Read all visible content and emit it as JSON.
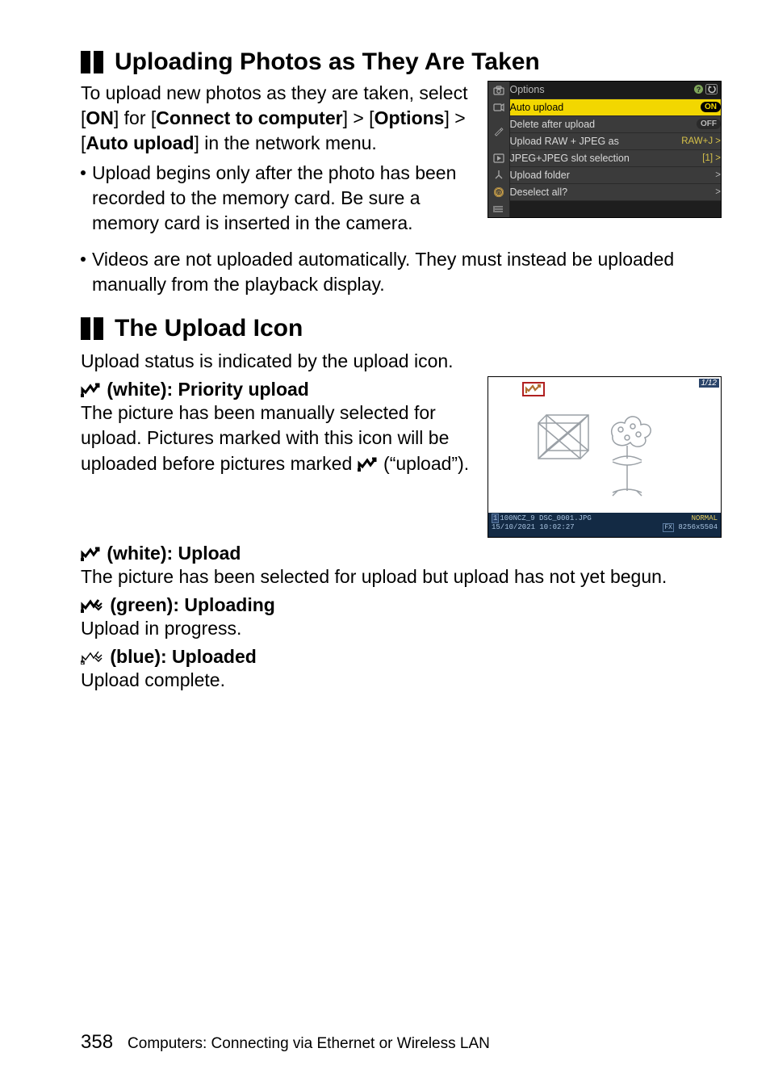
{
  "section1": {
    "heading": "Uploading Photos as They Are Taken",
    "intro_prefix": "To upload new photos as they are taken, select [",
    "intro_on": "ON",
    "intro_mid1": "] for [",
    "intro_connect": "Connect to computer",
    "intro_mid2": "] > [",
    "intro_options": "Options",
    "intro_mid3": "] > [",
    "intro_auto": "Auto upload",
    "intro_suffix": "] in the network menu.",
    "bullet1": "Upload begins only after the photo has been recorded to the memory card. Be sure a memory card is inserted in the camera.",
    "bullet2": "Videos are not uploaded automatically. They must instead be uploaded manually from the playback display."
  },
  "menu_screenshot": {
    "title": "Options",
    "rows": [
      {
        "label": "Auto upload",
        "value": "ON",
        "selected": true,
        "value_style": "pill"
      },
      {
        "label": "Delete after upload",
        "value": "OFF",
        "value_style": "pill-off"
      },
      {
        "label": "Upload RAW + JPEG as",
        "value": "RAW+J >",
        "value_style": "text"
      },
      {
        "label": "JPEG+JPEG slot selection",
        "value": "[1]  >",
        "value_style": "text"
      },
      {
        "label": "Upload folder",
        "value": ">",
        "value_style": "text"
      },
      {
        "label": "Deselect all?",
        "value": ">",
        "value_style": "text"
      }
    ],
    "side_icons": [
      "camera-icon",
      "video-icon",
      "pencil-icon",
      "play-icon",
      "tools-icon",
      "network-icon",
      "mymenu-icon"
    ]
  },
  "section2": {
    "heading": "The Upload Icon",
    "intro": "Upload status is indicated by the upload icon.",
    "sub1_label": " (white): Priority upload",
    "sub1_body_a": "The picture has been manually selected for upload. Pictures marked with this icon will be uploaded before pictures marked ",
    "sub1_body_b": " (“upload”).",
    "sub2_label": " (white): Upload",
    "sub2_body": "The picture has been selected for upload but upload has not yet begun.",
    "sub3_label": " (green): Uploading",
    "sub3_body": "Upload in progress.",
    "sub4_label": " (blue): Uploaded",
    "sub4_body": "Upload complete."
  },
  "playback_screenshot": {
    "counter": "1/12",
    "info_line1": "100NCZ_9 DSC_0001.JPG",
    "info_line2": "15/10/2021 10:02:27",
    "quality": "NORMAL",
    "resolution": "8256x5504"
  },
  "footer": {
    "page": "358",
    "label": "Computers: Connecting via Ethernet or Wireless LAN"
  }
}
